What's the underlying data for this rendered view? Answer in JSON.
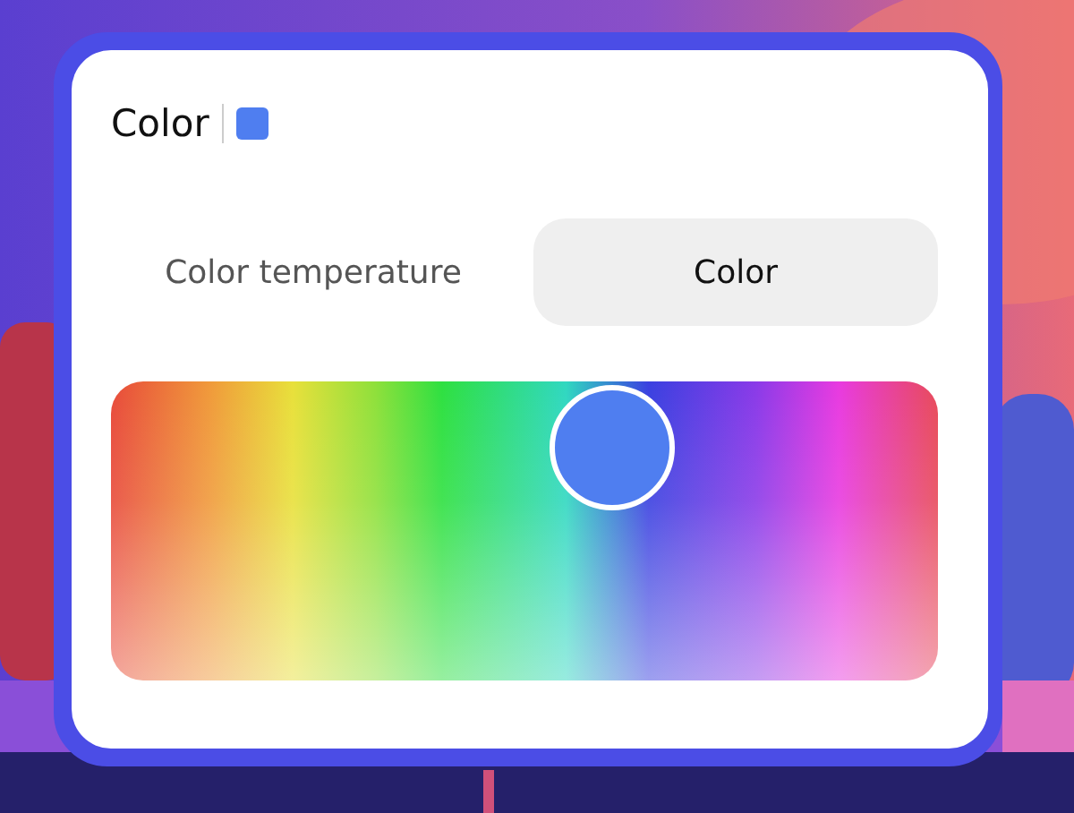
{
  "panel": {
    "title": "Color",
    "swatch": {
      "color": "#4f7ef0"
    }
  },
  "tabs": [
    {
      "label": "Color temperature",
      "selected": false
    },
    {
      "label": "Color",
      "selected": true
    }
  ],
  "picker": {
    "level": 0.606
  }
}
